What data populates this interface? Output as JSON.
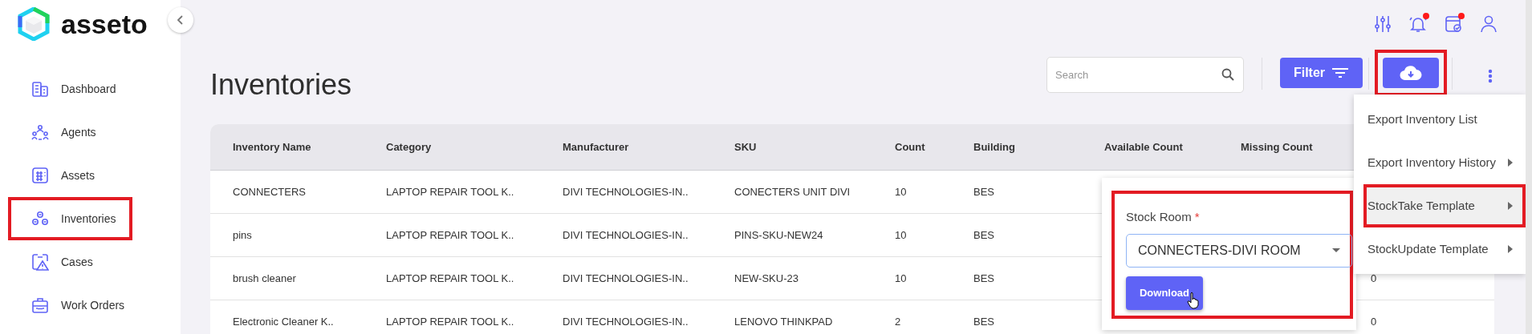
{
  "logo": {
    "text": "asseto"
  },
  "sidebar": {
    "items": [
      {
        "label": "Dashboard",
        "highlighted": false
      },
      {
        "label": "Agents",
        "highlighted": false
      },
      {
        "label": "Assets",
        "highlighted": false
      },
      {
        "label": "Inventories",
        "highlighted": true
      },
      {
        "label": "Cases",
        "highlighted": false
      },
      {
        "label": "Work Orders",
        "highlighted": false
      }
    ]
  },
  "header_icons": [
    {
      "kind": "sliders",
      "badge": false
    },
    {
      "kind": "bell",
      "badge": true
    },
    {
      "kind": "calendar",
      "badge": true
    },
    {
      "kind": "user",
      "badge": false
    }
  ],
  "page": {
    "title": "Inventories"
  },
  "search": {
    "placeholder": "Search"
  },
  "filter_button": {
    "label": "Filter"
  },
  "export_button": {
    "highlighted": true
  },
  "table": {
    "columns": [
      "Inventory Name",
      "Category",
      "Manufacturer",
      "SKU",
      "Count",
      "Building",
      "Available Count",
      "Missing Count"
    ],
    "rows": [
      {
        "cells": [
          "CONNECTERS",
          "LAPTOP REPAIR TOOL K..",
          "DIVI TECHNOLOGIES-IN..",
          "CONECTERS UNIT DIVI",
          "10",
          "BES"
        ]
      },
      {
        "cells": [
          "pins",
          "LAPTOP REPAIR TOOL K..",
          "DIVI TECHNOLOGIES-IN..",
          "PINS-SKU-NEW24",
          "10",
          "BES"
        ]
      },
      {
        "cells": [
          "brush cleaner",
          "LAPTOP REPAIR TOOL K..",
          "DIVI TECHNOLOGIES-IN..",
          "NEW-SKU-23",
          "10",
          "BES"
        ],
        "column_9": "0"
      },
      {
        "cells": [
          "Electronic Cleaner K..",
          "LAPTOP REPAIR TOOL K..",
          "DIVI TECHNOLOGIES-IN..",
          "LENOVO THINKPAD",
          "2",
          "BES"
        ],
        "column_9": "0"
      }
    ]
  },
  "export_menu": {
    "items": [
      {
        "label": "Export Inventory List",
        "submenu": false,
        "selected": false,
        "highlighted": false
      },
      {
        "label": "Export Inventory History",
        "submenu": true,
        "selected": false,
        "highlighted": false
      },
      {
        "label": "StockTake Template",
        "submenu": true,
        "selected": true,
        "highlighted": true
      },
      {
        "label": "StockUpdate Template",
        "submenu": true,
        "selected": false,
        "highlighted": false
      }
    ]
  },
  "stock_room_popup": {
    "label": "Stock Room",
    "required_mark": "*",
    "value": "CONNECTERS-DIVI ROOM",
    "button": "Download",
    "highlighted": true
  }
}
